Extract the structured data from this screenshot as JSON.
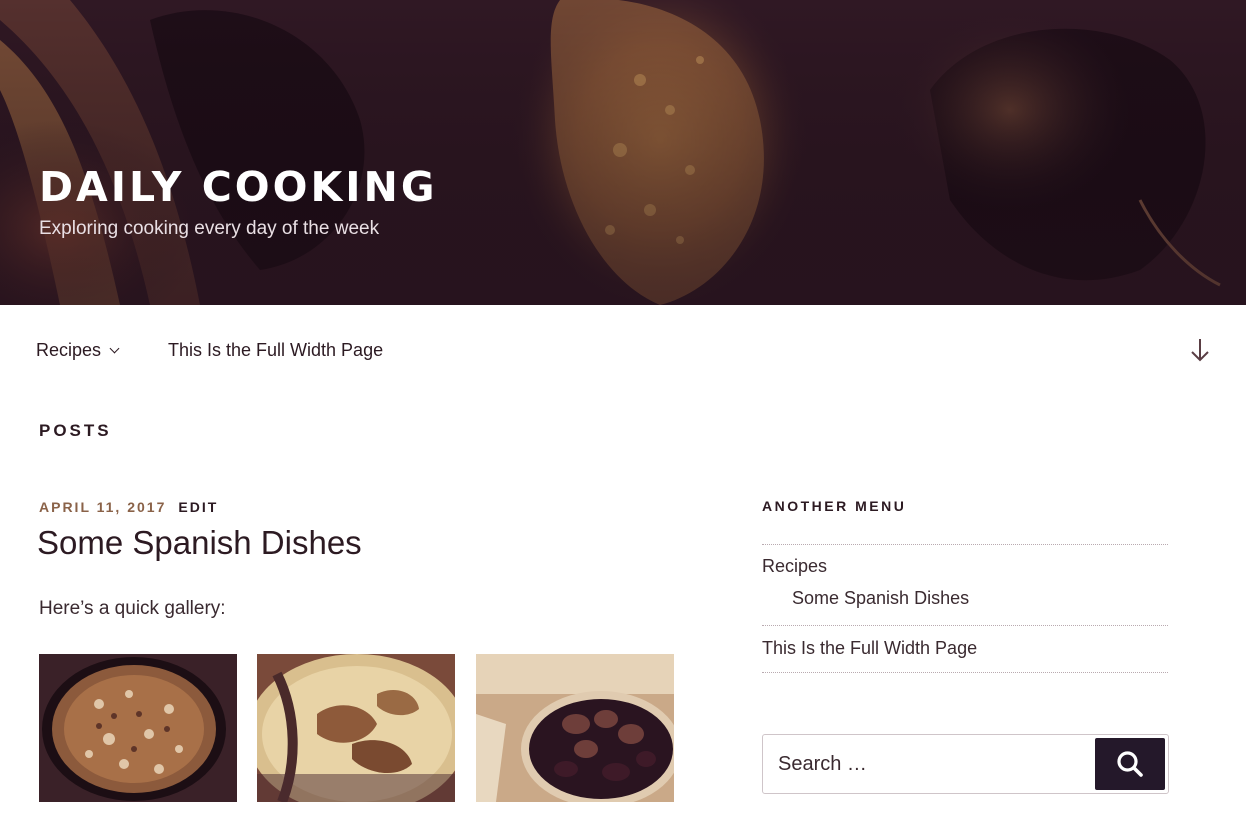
{
  "header": {
    "site_title": "DAILY COOKING",
    "site_description": "Exploring cooking every day of the week"
  },
  "nav": {
    "items": [
      {
        "label": "Recipes",
        "has_submenu": true
      },
      {
        "label": "This Is the Full Width Page",
        "has_submenu": false
      }
    ],
    "scroll_icon": "arrow-down-icon"
  },
  "page": {
    "heading": "POSTS"
  },
  "post": {
    "date": "APRIL 11, 2017",
    "edit_label": "EDIT",
    "title": "Some Spanish Dishes",
    "intro": "Here’s a quick gallery:",
    "gallery": [
      {
        "subject": "paella"
      },
      {
        "subject": "fried-fish"
      },
      {
        "subject": "mussels"
      }
    ]
  },
  "sidebar": {
    "menu_title": "ANOTHER MENU",
    "menu_items": [
      {
        "label": "Recipes"
      },
      {
        "label": "Some Spanish Dishes"
      },
      {
        "label": "This Is the Full Width Page"
      }
    ],
    "search": {
      "placeholder": "Search …",
      "value": "",
      "button_icon": "search-icon"
    }
  },
  "colors": {
    "accent": "#24182a",
    "meta_date": "#8a6248",
    "text": "#3a2a30"
  }
}
